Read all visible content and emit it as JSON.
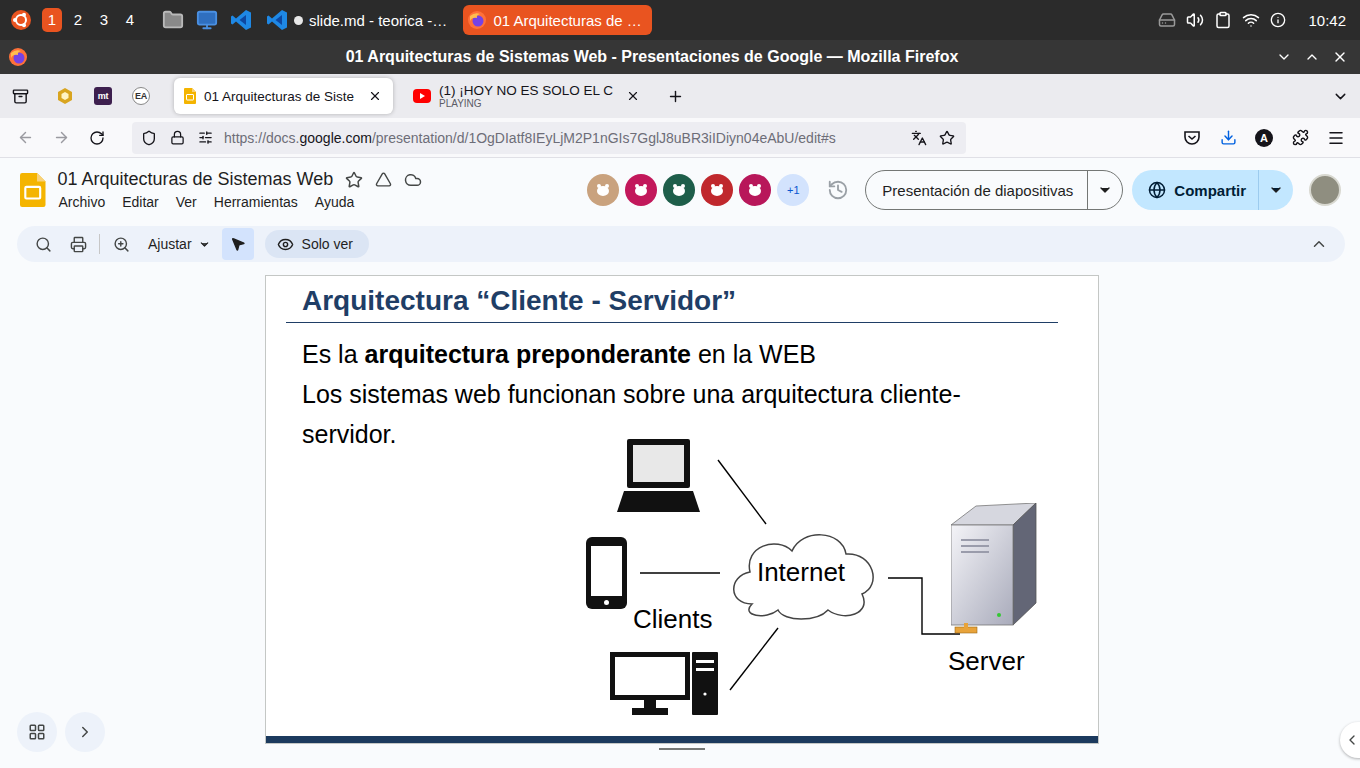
{
  "taskbar": {
    "workspaces": [
      {
        "label": "1",
        "selected": true
      },
      {
        "label": "2",
        "selected": false
      },
      {
        "label": "3",
        "selected": false
      },
      {
        "label": "4",
        "selected": false
      }
    ],
    "launchers": [
      {
        "kind": "files"
      },
      {
        "kind": "display"
      },
      {
        "kind": "vscode"
      }
    ],
    "windows": [
      {
        "kind": "vscode",
        "label": "slide.md - teorica -…",
        "modified": true,
        "selected": false
      },
      {
        "kind": "firefox",
        "label": "01 Arquitecturas de …",
        "modified": false,
        "selected": true
      }
    ],
    "clock": "10:42"
  },
  "window": {
    "title": "01 Arquitecturas de Sistemas Web - Presentaciones de Google — Mozilla Firefox"
  },
  "pinned_tabs": [
    {
      "kind": "icon",
      "color": "#d9a520"
    },
    {
      "kind": "text",
      "label": "mt",
      "color": "#3d1f4e"
    },
    {
      "kind": "text",
      "label": "EA",
      "color": "#ffffff"
    }
  ],
  "tabs": [
    {
      "kind": "slides",
      "label": "01 Arquitecturas de Siste",
      "selected": true
    },
    {
      "kind": "youtube",
      "label": "(1) ¡HOY NO ES SOLO EL C",
      "subtitle": "PLAYING",
      "selected": false
    }
  ],
  "address_bar": {
    "parts": [
      {
        "text": "https://docs.",
        "strong": false
      },
      {
        "text": "google.com",
        "strong": true
      },
      {
        "text": "/presentation/d/1OgDIatf8IEyLjM2P1nGIs7GglJ8uBR3iIDiyn04eAbU/edit#s",
        "strong": false
      }
    ]
  },
  "account": "A",
  "document": {
    "title": "01 Arquitecturas de Sistemas Web",
    "menus": [
      "Archivo",
      "Editar",
      "Ver",
      "Herramientas",
      "Ayuda"
    ]
  },
  "collaborators": [
    {
      "color": "#c9a27e"
    },
    {
      "color": "#c2185b"
    },
    {
      "color": "#1e5e4a"
    },
    {
      "color": "#c0282d"
    },
    {
      "color": "#b8175a"
    }
  ],
  "more_collaborators": "+1",
  "present_button": "Presentación de diapositivas",
  "share_button": "Compartir",
  "toolbar": {
    "zoom": "Ajustar",
    "select_tool_selected": true,
    "mode": "Solo ver"
  },
  "slide": {
    "title": "Arquitectura “Cliente - Servidor”",
    "lines": [
      [
        {
          "text": "Es la ",
          "bold": false
        },
        {
          "text": "arquitectura preponderante",
          "bold": true
        },
        {
          "text": " en la WEB",
          "bold": false
        }
      ],
      [
        {
          "text": "Los sistemas web funcionan sobre una arquitectura cliente-servidor.",
          "bold": false
        }
      ]
    ],
    "diagram": {
      "network": "Internet",
      "clients": "Clients",
      "server": "Server"
    }
  }
}
